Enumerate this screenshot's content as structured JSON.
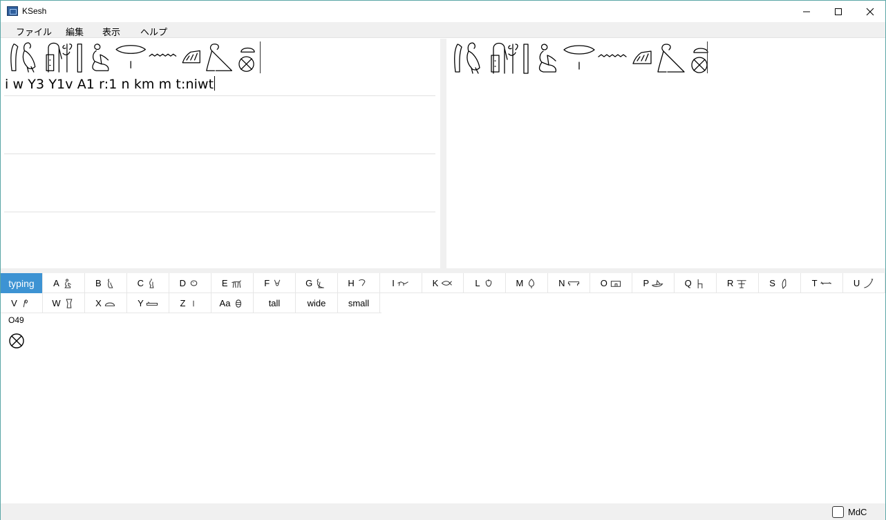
{
  "window": {
    "title": "KSesh"
  },
  "menu": {
    "items": [
      "ファイル",
      "編集",
      "表示",
      "ヘルプ"
    ]
  },
  "editor": {
    "mdc_text": "i w Y3 Y1v A1 r:1 n km m t:niwt",
    "glyphs": [
      "M17",
      "G43",
      "Y3",
      "Y1v",
      "A1",
      "D21",
      "Z1",
      "N35",
      "Aa1",
      "G17",
      "X1",
      "O49"
    ]
  },
  "palette": {
    "tabs_row1": [
      {
        "label": "typing",
        "icon": "none"
      },
      {
        "label": "A",
        "icon": "seated-man-icon"
      },
      {
        "label": "B",
        "icon": "seated-woman-icon"
      },
      {
        "label": "C",
        "icon": "deity-icon"
      },
      {
        "label": "D",
        "icon": "head-icon"
      },
      {
        "label": "E",
        "icon": "animal-icon"
      },
      {
        "label": "F",
        "icon": "animal-part-icon"
      },
      {
        "label": "G",
        "icon": "bird-icon"
      },
      {
        "label": "H",
        "icon": "bird-part-icon"
      },
      {
        "label": "I",
        "icon": "reptile-icon"
      },
      {
        "label": "K",
        "icon": "fish-icon"
      },
      {
        "label": "L",
        "icon": "beetle-icon"
      },
      {
        "label": "M",
        "icon": "tree-icon"
      },
      {
        "label": "N",
        "icon": "sky-icon"
      },
      {
        "label": "O",
        "icon": "building-icon"
      },
      {
        "label": "P",
        "icon": "boat-icon"
      },
      {
        "label": "Q",
        "icon": "furniture-icon"
      },
      {
        "label": "R",
        "icon": "temple-icon"
      },
      {
        "label": "S",
        "icon": "crown-icon"
      },
      {
        "label": "T",
        "icon": "weapon-icon"
      },
      {
        "label": "U",
        "icon": "tool-icon"
      }
    ],
    "tabs_row2": [
      {
        "label": "V",
        "icon": "rope-icon"
      },
      {
        "label": "W",
        "icon": "vessel-icon"
      },
      {
        "label": "X",
        "icon": "bread-icon"
      },
      {
        "label": "Y",
        "icon": "writing-icon"
      },
      {
        "label": "Z",
        "icon": "stroke-icon"
      },
      {
        "label": "Aa",
        "icon": "unclassified-icon"
      },
      {
        "label": "tall",
        "icon": "none"
      },
      {
        "label": "wide",
        "icon": "none"
      },
      {
        "label": "small",
        "icon": "none"
      }
    ],
    "selected_sign": {
      "code": "O49"
    }
  },
  "status": {
    "mdc_label": "MdC",
    "mdc_checked": false
  }
}
